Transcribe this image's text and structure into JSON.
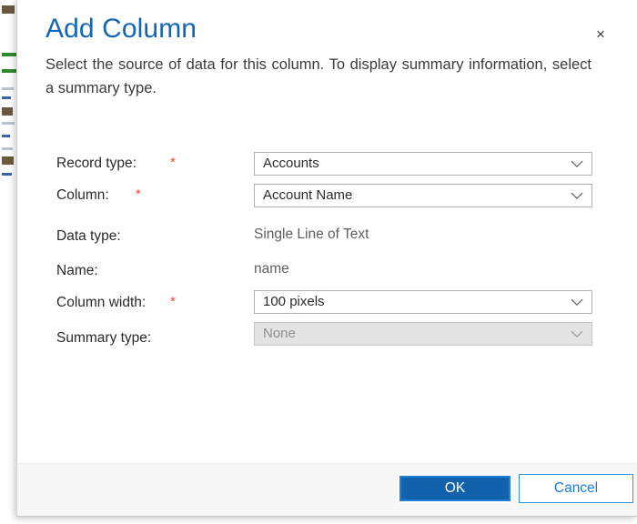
{
  "dialog": {
    "title": "Add Column",
    "subtitle": "Select the source of data for this column. To display summary information, select a summary type.",
    "close_label": "×",
    "close_icon": "close-icon"
  },
  "form": {
    "rows": [
      {
        "label": "Record type:",
        "required": true,
        "required_marker": "*",
        "control": "dropdown",
        "value": "Accounts",
        "disabled": false,
        "icon": "chevron-down-icon"
      },
      {
        "label": "Column:",
        "required": true,
        "required_marker": "*",
        "control": "dropdown",
        "value": "Account Name",
        "disabled": false,
        "icon": "chevron-down-icon"
      },
      {
        "label": "Data type:",
        "required": false,
        "required_marker": "",
        "control": "readonly",
        "value": "Single Line of Text",
        "disabled": false,
        "icon": ""
      },
      {
        "label": "Name:",
        "required": false,
        "required_marker": "",
        "control": "readonly",
        "value": "name",
        "disabled": false,
        "icon": ""
      },
      {
        "label": "Column width:",
        "required": true,
        "required_marker": "*",
        "control": "dropdown",
        "value": "100 pixels",
        "disabled": false,
        "icon": "chevron-down-icon"
      },
      {
        "label": "Summary type:",
        "required": false,
        "required_marker": "",
        "control": "dropdown",
        "value": "None",
        "disabled": true,
        "icon": "chevron-down-icon"
      }
    ]
  },
  "footer": {
    "ok_label": "OK",
    "cancel_label": "Cancel"
  },
  "colors": {
    "title_blue": "#1566b8",
    "primary_button": "#1161ad",
    "secondary_button_text": "#1a7bd4",
    "required_asterisk": "#e8483a",
    "label_text": "#2b2a29",
    "readonly_text": "#605e5c",
    "disabled_field_bg": "#e3e3e3",
    "footer_bg": "#f7f7f7"
  }
}
